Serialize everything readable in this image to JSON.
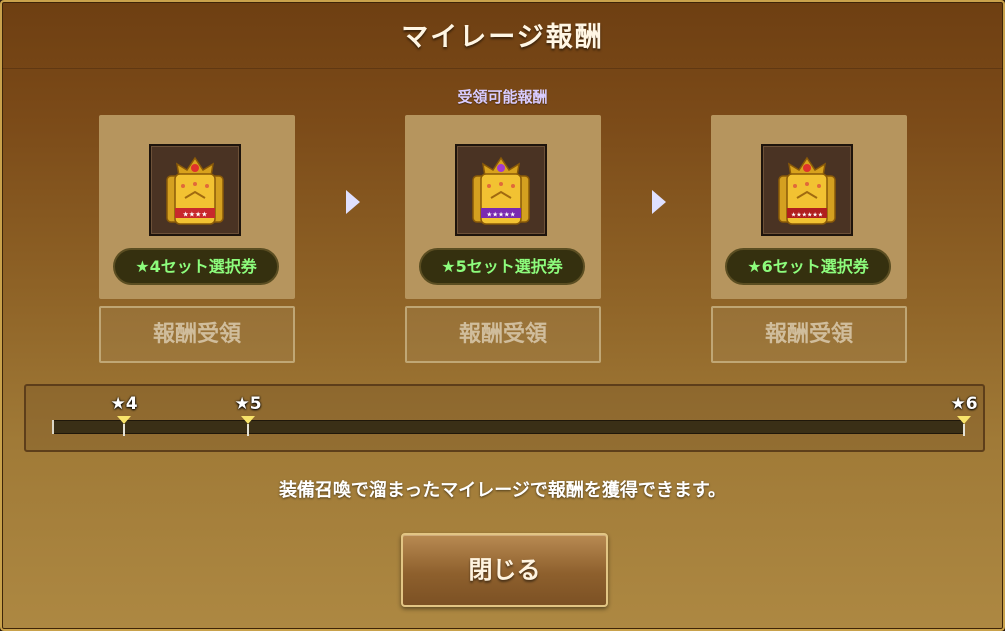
{
  "dialog": {
    "title": "マイレージ報酬",
    "subtitle": "受領可能報酬"
  },
  "rewards": [
    {
      "label": "★4セット選択券",
      "button_label": "報酬受領",
      "icon": "star4-set-ticket-icon"
    },
    {
      "label": "★5セット選択券",
      "button_label": "報酬受領",
      "icon": "star5-set-ticket-icon"
    },
    {
      "label": "★6セット選択券",
      "button_label": "報酬受領",
      "icon": "star6-set-ticket-icon"
    }
  ],
  "progress": {
    "value": 0,
    "markers": [
      "★4",
      "★5",
      "★6"
    ]
  },
  "info_text": "装備召喚で溜まったマイレージで報酬を獲得できます。",
  "close_label": "閉じる",
  "colors": {
    "label_text": "#8dfc7c",
    "subtitle": "#d9ccff",
    "marker": "#f7e36a"
  }
}
